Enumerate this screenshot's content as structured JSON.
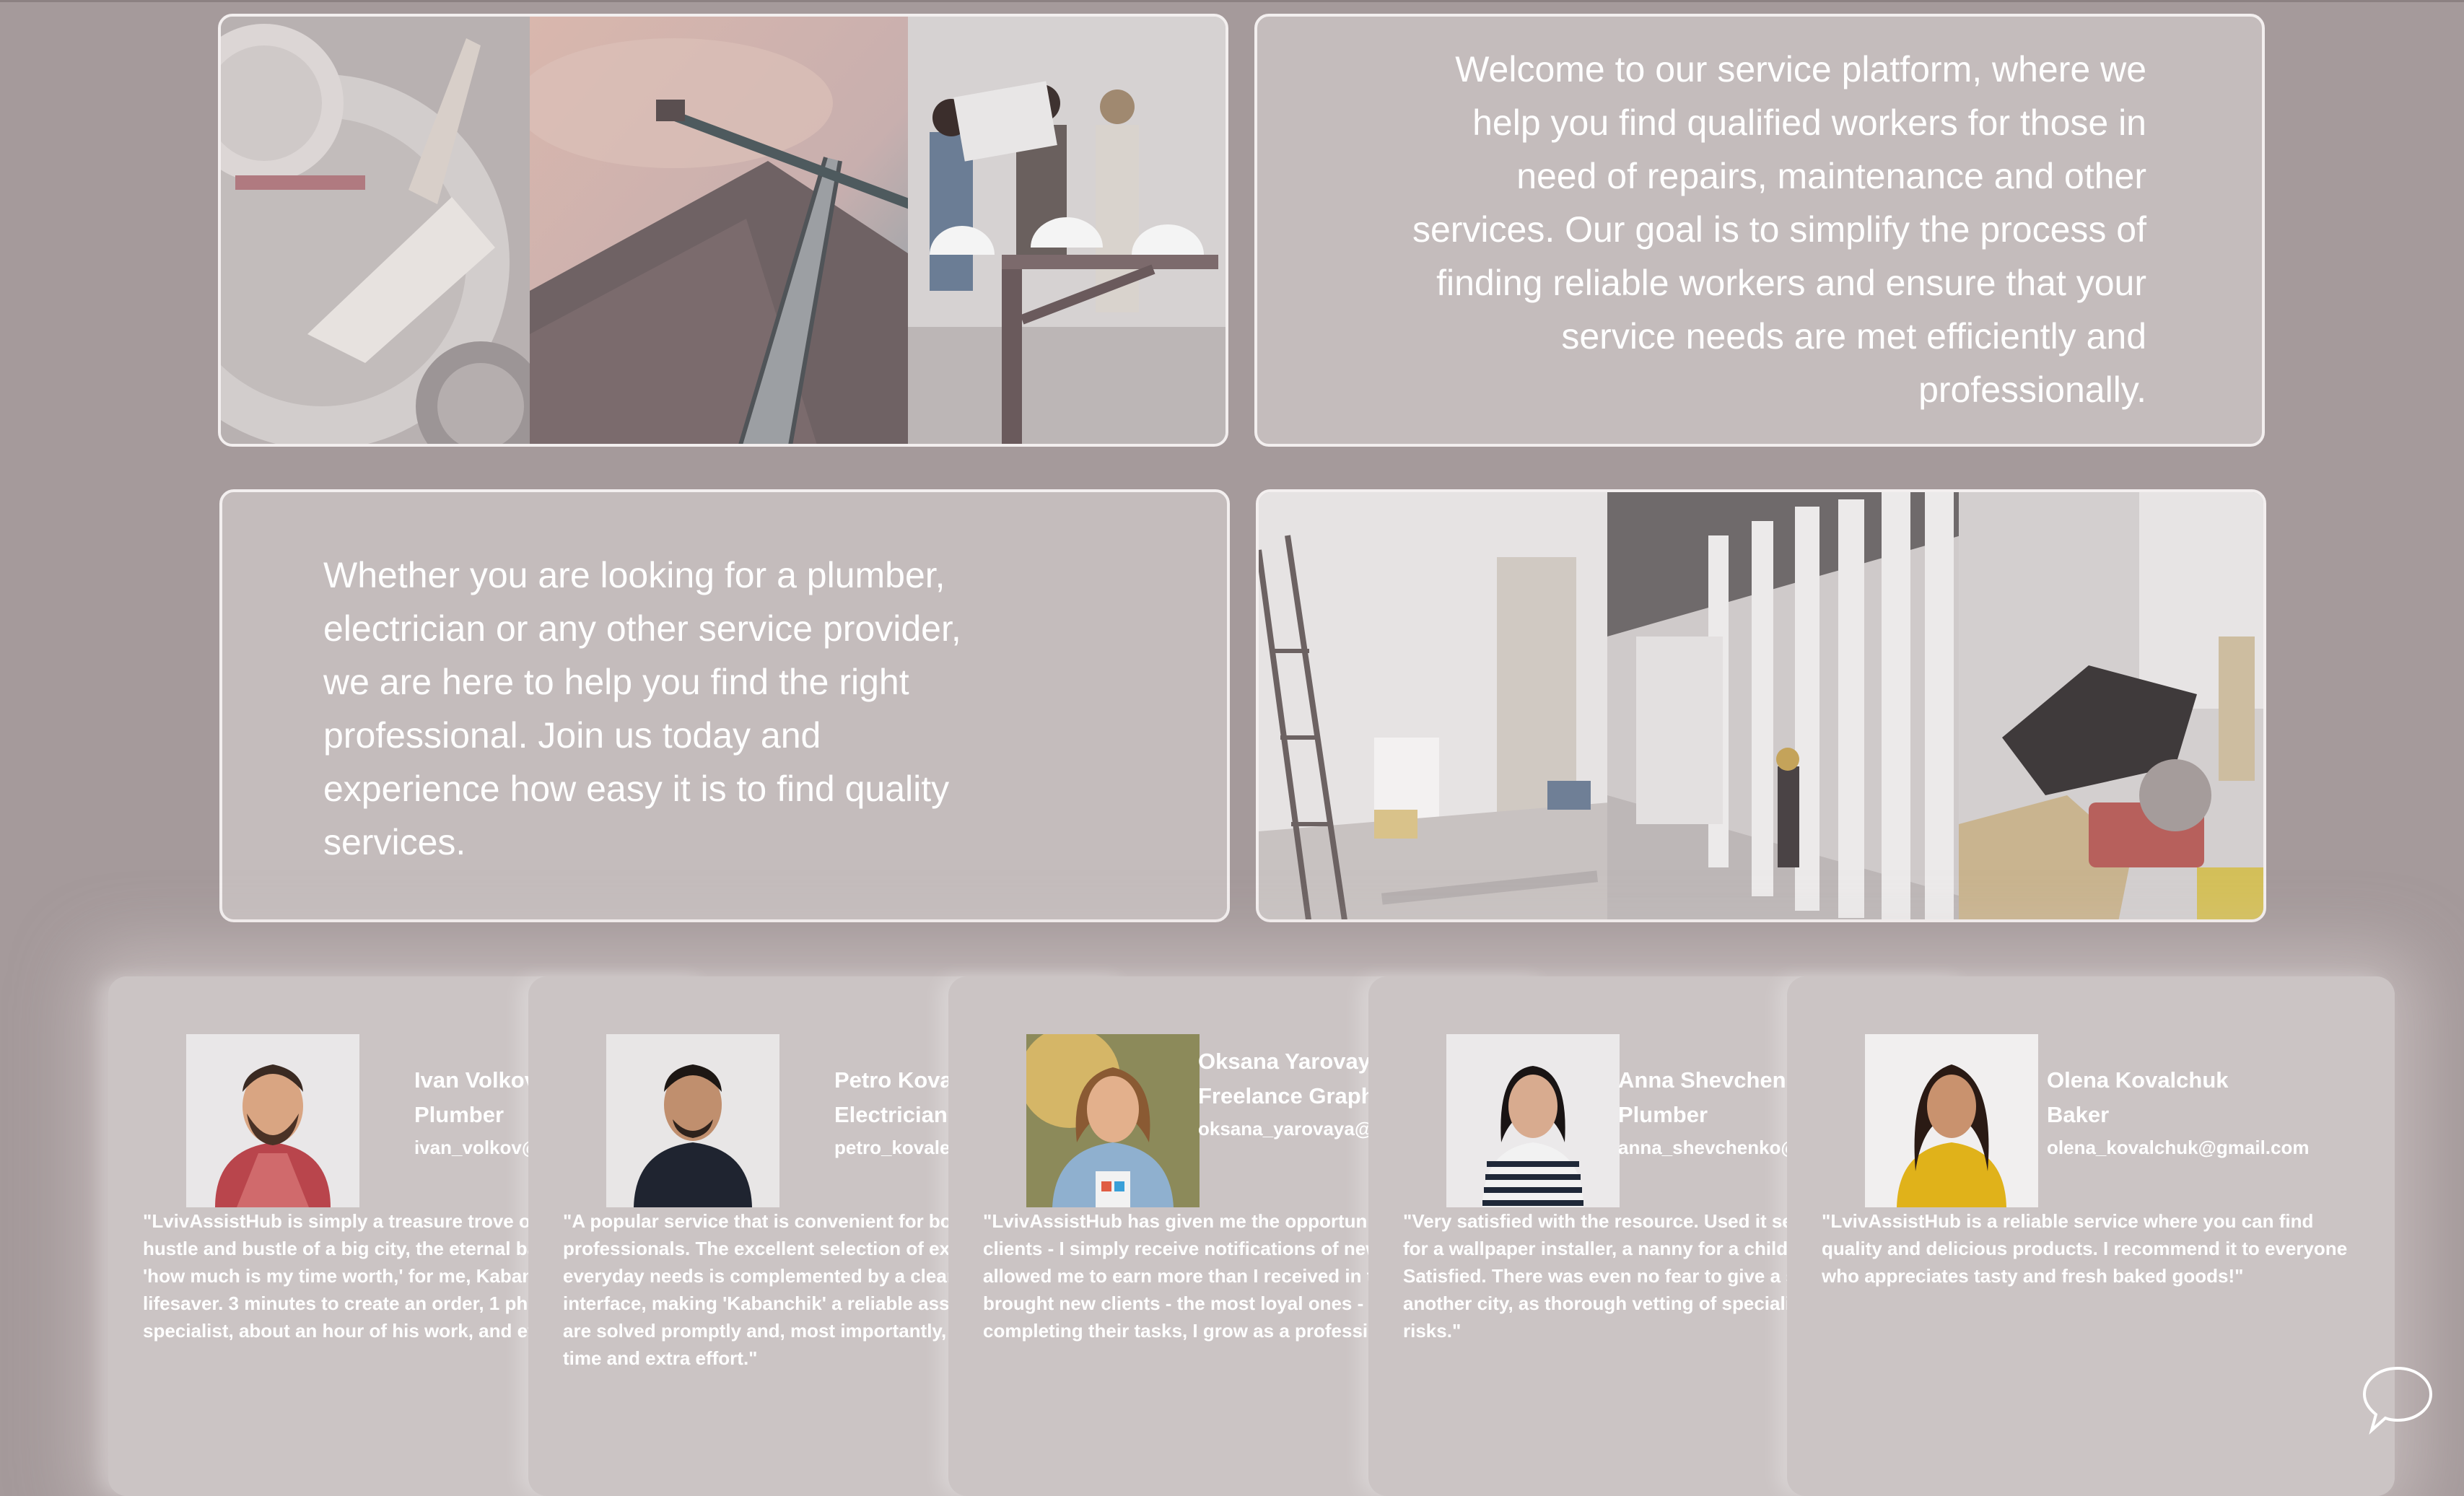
{
  "intro": {
    "welcome_text": "Welcome to our service platform, where we help you find qualified workers for those in need of repairs, maintenance and other services. Our goal is to simplify the process of finding reliable workers and ensure that your service needs are met efficiently and professionally.",
    "whether_text": "Whether you are looking for a plumber, electrician or any other service provider, we are here to help you find the right professional. Join us today and experience how easy it is to find quality services."
  },
  "reviews": [
    {
      "name": "Ivan Volkov",
      "role": "Plumber",
      "email": "ivan_volkov@gmail.com",
      "text": "\"LvivAssistHub is simply a treasure trove of specialists in the hustle and bustle of a big city, the eternal battle with time and 'how much is my time worth,' for me, Kabanchik became a lifesaver. 3 minutes to create an order, 1 phone call with a specialist, about an hour of his work, and everyone is happy!\""
    },
    {
      "name": "Petro Kovalenko",
      "role": "Electrician",
      "email": "petro_kovalenko@gmail.com",
      "text": "\"A popular service that is convenient for both clients and professionals. The excellent selection of experts for people's everyday needs is complemented by a clear and informative interface, making 'Kabanchik' a reliable assistant. Problems are solved promptly and, most importantly, without wasting time and extra effort.\""
    },
    {
      "name": "Oksana Yarovaya",
      "role": "Freelance Graphic Designer",
      "email": "oksana_yarovaya@gmail.com",
      "text": "\"LvivAssistHub has given me the opportunity to easily find clients - I simply receive notifications of new orders. It has allowed me to earn more than I received in the office. It has brought new clients - the most loyal ones - entrepreneurs. By completing their tasks, I grow as a professional.\""
    },
    {
      "name": "Anna Shevchenko",
      "role": "Plumber",
      "email": "anna_shevchenko@gmail.com",
      "text": "\"Very satisfied with the resource. Used it several times, looked for a wallpaper installer, a nanny for a child, a seamstress. Satisfied. There was even no fear to give a sewing order to another city, as thorough vetting of specialists minimized risks.\""
    },
    {
      "name": "Olena Kovalchuk",
      "role": "Baker",
      "email": "olena_kovalchuk@gmail.com",
      "text": "\"LvivAssistHub is a reliable service where you can find quality and delicious products. I recommend it to everyone who appreciates tasty and fresh baked goods!\""
    }
  ],
  "chat": {
    "icon": "chat-bubble-icon"
  }
}
